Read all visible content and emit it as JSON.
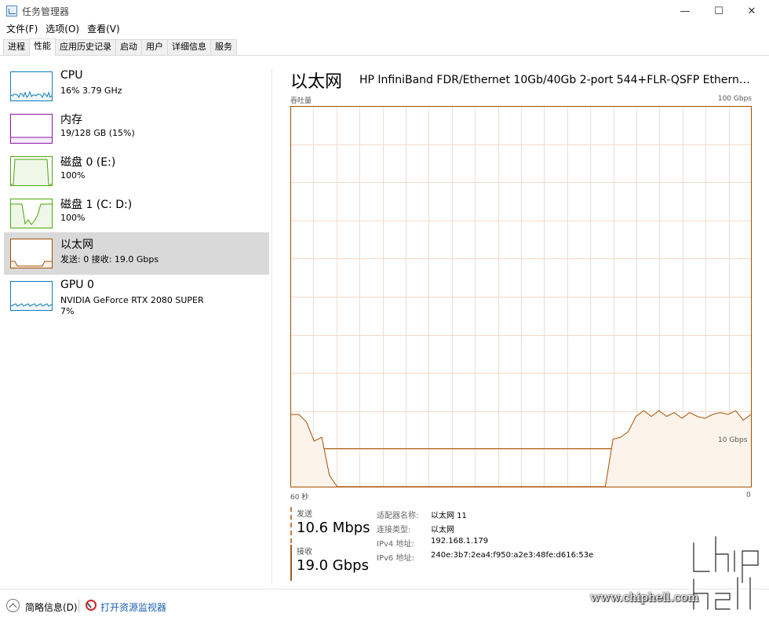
{
  "window": {
    "title": "任务管理器",
    "minimize": "—",
    "maximize": "☐",
    "close": "✕"
  },
  "menu": [
    "文件(F)",
    "选项(O)",
    "查看(V)"
  ],
  "tabs": [
    "进程",
    "性能",
    "应用历史记录",
    "启动",
    "用户",
    "详细信息",
    "服务"
  ],
  "active_tab": "性能",
  "sidebar": {
    "items": [
      {
        "title": "CPU",
        "sub": "16% 3.79 GHz",
        "sub2": "",
        "color": "#117dbb",
        "fill": "#f1f6fa"
      },
      {
        "title": "内存",
        "sub": "19/128 GB (15%)",
        "sub2": "",
        "color": "#8b12ae",
        "fill": "#f4eef7"
      },
      {
        "title": "磁盘 0 (E:)",
        "sub": "100%",
        "sub2": "",
        "color": "#4da60c",
        "fill": "#eff7e8"
      },
      {
        "title": "磁盘 1 (C: D:)",
        "sub": "100%",
        "sub2": "",
        "color": "#4da60c",
        "fill": "#eff7e8"
      },
      {
        "title": "以太网",
        "sub": "发送: 0 接收: 19.0 Gbps",
        "sub2": "",
        "color": "#a74f01",
        "fill": "#fcf3eb"
      },
      {
        "title": "GPU 0",
        "sub": "NVIDIA GeForce RTX 2080 SUPER",
        "sub2": "7%",
        "color": "#117dbb",
        "fill": "#f1f6fa"
      }
    ],
    "selected_index": 4
  },
  "main": {
    "title": "以太网",
    "device": "HP InfiniBand FDR/Ethernet 10Gb/40Gb 2-port 544+FLR-QSFP Etherne...",
    "throughput_label": "吞吐量",
    "max_label": "100 Gbps",
    "time_label": "60 秒",
    "zero_label": "0",
    "ref_label": "10 Gbps"
  },
  "stats": {
    "send_label": "发送",
    "send_value": "10.6 Mbps",
    "recv_label": "接收",
    "recv_value": "19.0 Gbps"
  },
  "info": [
    {
      "label": "适配器名称:",
      "value": "以太网 11"
    },
    {
      "label": "连接类型:",
      "value": "以太网"
    },
    {
      "label": "IPv4 地址:",
      "value": "192.168.1.179"
    },
    {
      "label": "IPv6 地址:",
      "value": "240e:3b7:2ea4:f950:a2e3:48fe:d616:53e"
    }
  ],
  "footer": {
    "brief": "简略信息(D)",
    "resource_monitor": "打开资源监视器"
  },
  "watermark": {
    "site": "www.chiphell.com",
    "logo": "chip hell"
  },
  "chart_data": {
    "type": "line",
    "title": "",
    "xlabel": "60 秒",
    "ylabel": "吞吐量",
    "xlim": [
      60,
      0
    ],
    "ylim": [
      0,
      100
    ],
    "ylim_unit": "Gbps",
    "reference_line": 10,
    "series": [
      {
        "name": "",
        "color": "#a74f01",
        "x": [
          60,
          59,
          58,
          57,
          56,
          55,
          54,
          53,
          52,
          51,
          50,
          49,
          48,
          47,
          46,
          45,
          44,
          43,
          42,
          41,
          40,
          39,
          38,
          37,
          36,
          35,
          34,
          33,
          32,
          31,
          30,
          29,
          28,
          27,
          26,
          25,
          24,
          23,
          22,
          21,
          20,
          19,
          18,
          17,
          16,
          15,
          14,
          13,
          12,
          11,
          10,
          9,
          8,
          7,
          6,
          5,
          4,
          3,
          2,
          1,
          0
        ],
        "values": [
          19.0,
          19.0,
          17.0,
          12.0,
          13.0,
          3.0,
          0,
          0,
          0,
          0,
          0,
          0,
          0,
          0,
          0,
          0,
          0,
          0,
          0,
          0,
          0,
          0,
          0,
          0,
          0,
          0,
          0,
          0,
          0,
          0,
          0,
          0,
          0,
          0,
          0,
          0,
          0,
          0,
          0,
          0,
          0,
          0,
          12.5,
          13.0,
          14.5,
          18.5,
          20.0,
          18.5,
          20.0,
          18.5,
          19.5,
          18.0,
          19.5,
          18.5,
          18.0,
          19.0,
          19.5,
          19.0,
          20.0,
          17.5,
          19.0
        ]
      }
    ],
    "grid": true,
    "legend": "none"
  }
}
